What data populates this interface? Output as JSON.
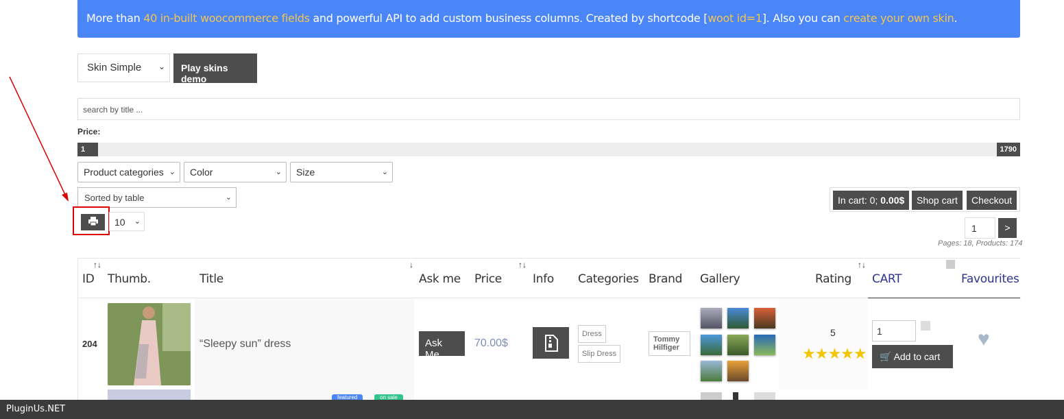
{
  "banner": {
    "part1": "More than ",
    "link1": "40 in-built woocommerce fields",
    "part2": " and powerful API to add custom business columns. Created by shortcode [",
    "link2": "woot id=1",
    "part3": "]. Also you can ",
    "link3": "create your own skin",
    "part4": "."
  },
  "skin": {
    "selected": "Skin Simple",
    "play_label": "Play skins demo"
  },
  "search": {
    "placeholder": "search by title ..."
  },
  "price": {
    "label": "Price:",
    "min": "1",
    "max": "1790"
  },
  "filters": {
    "categories": "Product categories",
    "color": "Color",
    "size": "Size",
    "sort": "Sorted by table"
  },
  "toolbar": {
    "per_page": "10"
  },
  "cart_bar": {
    "in_cart_prefix": "In cart: 0; ",
    "in_cart_total": "0.00$",
    "shop_cart": "Shop cart",
    "checkout": "Checkout"
  },
  "pagination": {
    "current": "1",
    "next": ">",
    "info": "Pages: 18, Products: 174"
  },
  "table": {
    "headers": [
      "ID",
      "Thumb.",
      "Title",
      "Ask me",
      "Price",
      "Info",
      "Categories",
      "Brand",
      "Gallery",
      "Rating",
      "CART",
      "Favourites"
    ],
    "sort_mark_both": "↑↓",
    "sort_mark_down": "↓",
    "row": {
      "id": "204",
      "title": "“Sleepy sun” dress",
      "ask_me": "Ask Me",
      "price": "70.00$",
      "categories": [
        "Dress",
        "Slip Dress"
      ],
      "brand": "Tommy Hilfiger",
      "rating": "5",
      "stars": "★★★★★",
      "qty": "1",
      "add_to_cart": "Add to cart"
    },
    "badges": [
      "featured",
      "on sale"
    ]
  },
  "footer": {
    "text": "PluginUs.NET"
  },
  "colors": {
    "banner": "#4a86f7",
    "highlight": "#f3c44f",
    "button": "#4d4d4d",
    "annotation": "#dd0000",
    "link": "#2b3490"
  }
}
